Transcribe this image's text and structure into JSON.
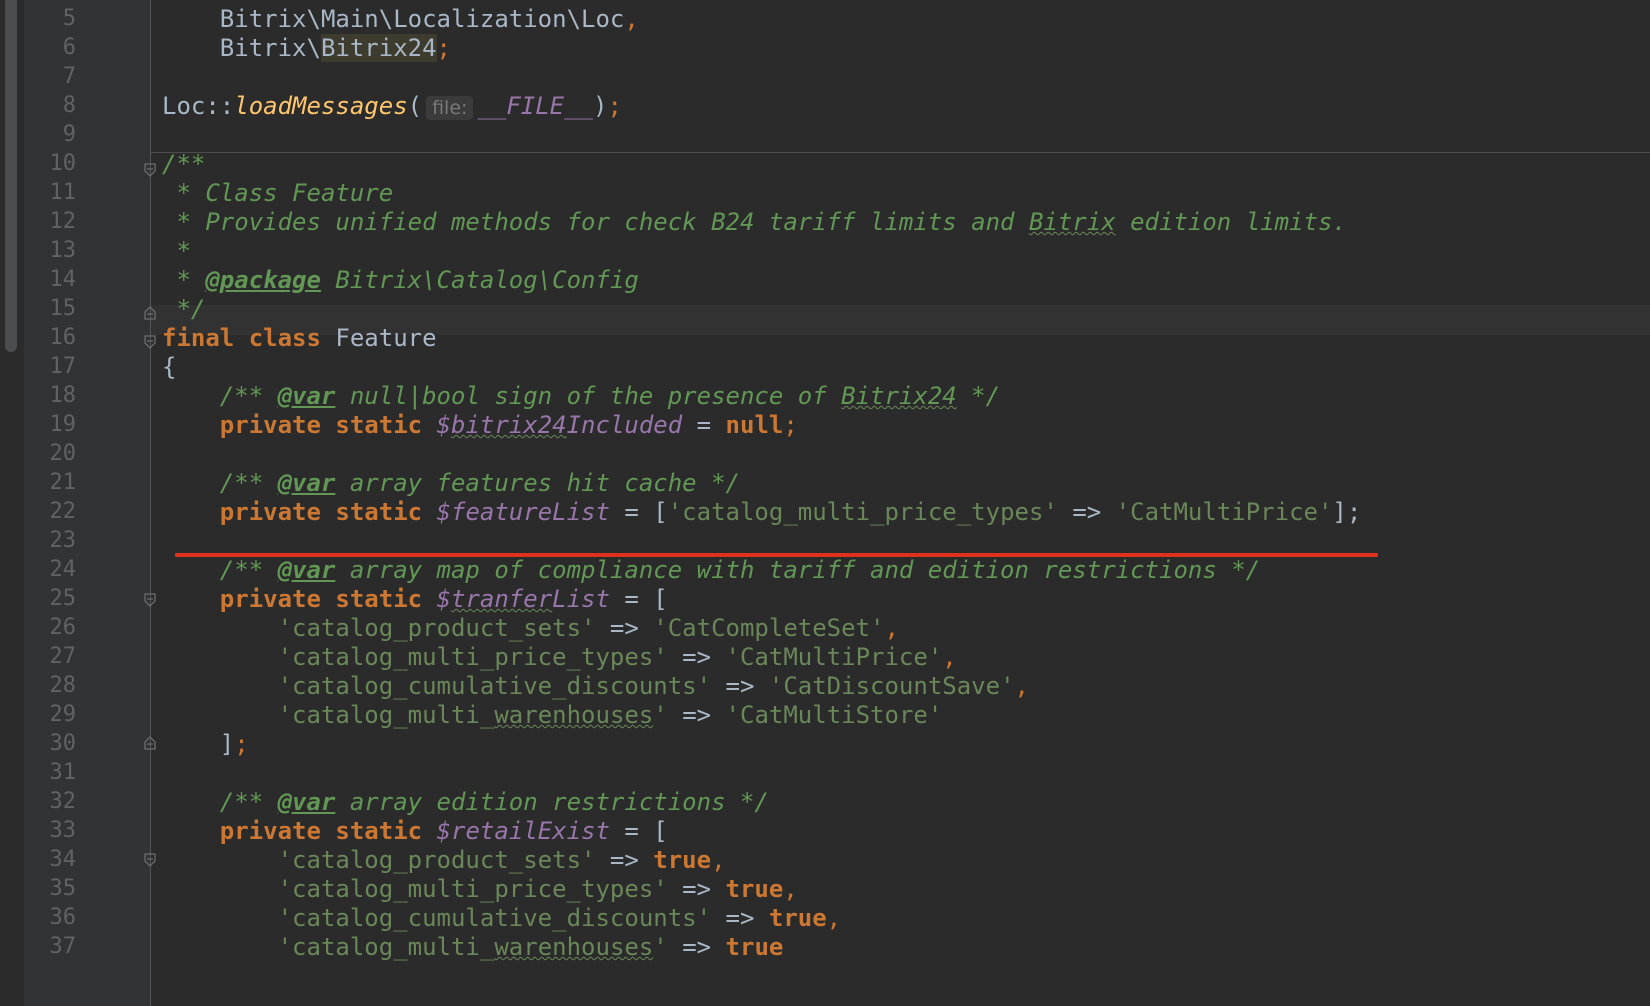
{
  "editor": {
    "language": "PHP",
    "theme_colors": {
      "background": "#2b2b2b",
      "gutter": "#313335",
      "keyword": "#cc7832",
      "string": "#6a8759",
      "doc_comment": "#629755",
      "variable": "#9876aa",
      "function": "#ffc66d",
      "error_underline": "#e0301e"
    },
    "lines": [
      {
        "n": "5",
        "text": "    Bitrix\\Main\\Localization\\Loc,"
      },
      {
        "n": "6",
        "text": "    Bitrix\\Bitrix24;"
      },
      {
        "n": "7",
        "text": ""
      },
      {
        "n": "8",
        "text": "Loc::loadMessages( file: __FILE__);"
      },
      {
        "n": "9",
        "text": ""
      },
      {
        "n": "10",
        "text": "/**"
      },
      {
        "n": "11",
        "text": " * Class Feature"
      },
      {
        "n": "12",
        "text": " * Provides unified methods for check B24 tariff limits and Bitrix edition limits."
      },
      {
        "n": "13",
        "text": " *"
      },
      {
        "n": "14",
        "text": " * @package Bitrix\\Catalog\\Config"
      },
      {
        "n": "15",
        "text": " */"
      },
      {
        "n": "16",
        "text": "final class Feature"
      },
      {
        "n": "17",
        "text": "{"
      },
      {
        "n": "18",
        "text": "    /** @var null|bool sign of the presence of Bitrix24 */"
      },
      {
        "n": "19",
        "text": "    private static $bitrix24Included = null;"
      },
      {
        "n": "20",
        "text": ""
      },
      {
        "n": "21",
        "text": "    /** @var array features hit cache */"
      },
      {
        "n": "22",
        "text": "    private static $featureList = ['catalog_multi_price_types' => 'CatMultiPrice'];"
      },
      {
        "n": "23",
        "text": ""
      },
      {
        "n": "24",
        "text": "    /** @var array map of compliance with tariff and edition restrictions */"
      },
      {
        "n": "25",
        "text": "    private static $tranferList = ["
      },
      {
        "n": "26",
        "text": "        'catalog_product_sets' => 'CatCompleteSet',"
      },
      {
        "n": "27",
        "text": "        'catalog_multi_price_types' => 'CatMultiPrice',"
      },
      {
        "n": "28",
        "text": "        'catalog_cumulative_discounts' => 'CatDiscountSave',"
      },
      {
        "n": "29",
        "text": "        'catalog_multi_warenhouses' => 'CatMultiStore'"
      },
      {
        "n": "30",
        "text": "    ];"
      },
      {
        "n": "31",
        "text": ""
      },
      {
        "n": "32",
        "text": "    /** @var array edition restrictions */"
      },
      {
        "n": "33",
        "text": "    private static $retailExist = ["
      },
      {
        "n": "34",
        "text": "        'catalog_product_sets' => true,"
      },
      {
        "n": "35",
        "text": "        'catalog_multi_price_types' => true,"
      },
      {
        "n": "36",
        "text": "        'catalog_cumulative_discounts' => true,"
      },
      {
        "n": "37",
        "text": "        'catalog_multi_warenhouses' => true"
      }
    ],
    "tokens": {
      "l5": [
        "    Bitrix\\Main\\Localization\\Loc",
        ","
      ],
      "l6": [
        "    Bitrix\\",
        "Bitrix24",
        ";"
      ],
      "l8": [
        "Loc::",
        "loadMessages",
        "(",
        "file:",
        "__FILE__",
        ")",
        ";"
      ],
      "l10": [
        "/**"
      ],
      "l11": [
        " * Class Feature"
      ],
      "l12": [
        " * Provides unified methods for check B24 tariff limits and ",
        "Bitrix",
        " edition limits."
      ],
      "l13": [
        " *"
      ],
      "l14": [
        " * ",
        "@package",
        " Bitrix\\Catalog\\Config"
      ],
      "l15": [
        " */"
      ],
      "l16": [
        "final",
        " ",
        "class",
        " Feature"
      ],
      "l17": [
        "{"
      ],
      "l18": [
        "    /** ",
        "@var",
        " null|bool sign of the presence of ",
        "Bitrix24",
        " */"
      ],
      "l19": [
        "    ",
        "private static",
        " ",
        "$",
        "bitrix24",
        "Included",
        " = ",
        "null",
        ";"
      ],
      "l21": [
        "    /** ",
        "@var",
        " array features hit cache */"
      ],
      "l22": [
        "    ",
        "private static",
        " ",
        "$featureList",
        " = [",
        "'catalog_multi_price_types'",
        " => ",
        "'CatMultiPrice'",
        "];"
      ],
      "l24": [
        "    /** ",
        "@var",
        " array map of compliance with tariff and edition restrictions */"
      ],
      "l25": [
        "    ",
        "private static",
        " ",
        "$",
        "tranfer",
        "List",
        " = ["
      ],
      "l26": [
        "        ",
        "'catalog_product_sets'",
        " => ",
        "'CatCompleteSet'",
        ","
      ],
      "l27": [
        "        ",
        "'catalog_multi_price_types'",
        " => ",
        "'CatMultiPrice'",
        ","
      ],
      "l28": [
        "        ",
        "'catalog_cumulative_discounts'",
        " => ",
        "'CatDiscountSave'",
        ","
      ],
      "l29": [
        "        ",
        "'catalog_multi_",
        "warenhouses",
        "'",
        " => ",
        "'CatMultiStore'"
      ],
      "l30": [
        "    ]",
        ";"
      ],
      "l32": [
        "    /** ",
        "@var",
        " array edition restrictions */"
      ],
      "l33": [
        "    ",
        "private static",
        " ",
        "$retailExist",
        " = ["
      ],
      "l34": [
        "        ",
        "'catalog_product_sets'",
        " => ",
        "true",
        ","
      ],
      "l35": [
        "        ",
        "'catalog_multi_price_types'",
        " => ",
        "true",
        ","
      ],
      "l36": [
        "        ",
        "'catalog_cumulative_discounts'",
        " => ",
        "true",
        ","
      ],
      "l37": [
        "        ",
        "'catalog_multi_",
        "warenhouses",
        "'",
        " => ",
        "true"
      ]
    }
  }
}
